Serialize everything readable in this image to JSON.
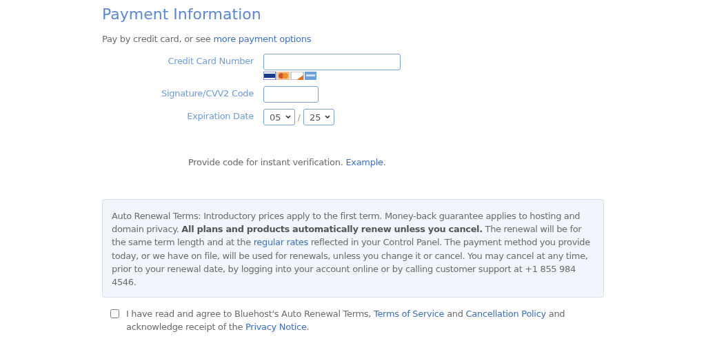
{
  "heading": "Payment Information",
  "intro": [
    {
      "text": "Pay by credit card, or see "
    },
    {
      "link": "more payment options"
    }
  ],
  "fields": [
    {
      "label": "Credit Card Number",
      "kind": "card"
    },
    {
      "label": "Signature/CVV2 Code",
      "kind": "cvv"
    },
    {
      "label": "Expiration Date",
      "kind": "date",
      "month": "05",
      "separator": "/",
      "year": "25"
    }
  ],
  "verification": [
    {
      "text": "Provide code for instant verification. "
    },
    {
      "link": "Example"
    },
    {
      "text": "."
    }
  ],
  "terms": [
    {
      "text": "Auto Renewal Terms: Introductory prices apply to the first term. Money-back guarantee applies to hosting and domain privacy. **All plans and products automatically renew unless you cancel.** The renewal will be for the same term length and at the "
    },
    {
      "link": "regular rates"
    },
    {
      "text": " reflected in your Control Panel. The payment method you provide today, or we have on file, will be used for renewals, unless you change it or cancel. You may cancel at any time, prior to your renewal date, by logging into your account online or by calling customer support at +1 855 984 4546."
    }
  ],
  "agreement": {
    "checked": false,
    "parts": [
      {
        "text": "I have read and agree to Bluehost's Auto Renewal Terms, "
      },
      {
        "link": "Terms of Service"
      },
      {
        "text": " and "
      },
      {
        "link": "Cancellation Policy"
      },
      {
        "text": " and acknowledge receipt of the "
      },
      {
        "link": "Privacy Notice"
      },
      {
        "text": "."
      }
    ]
  }
}
